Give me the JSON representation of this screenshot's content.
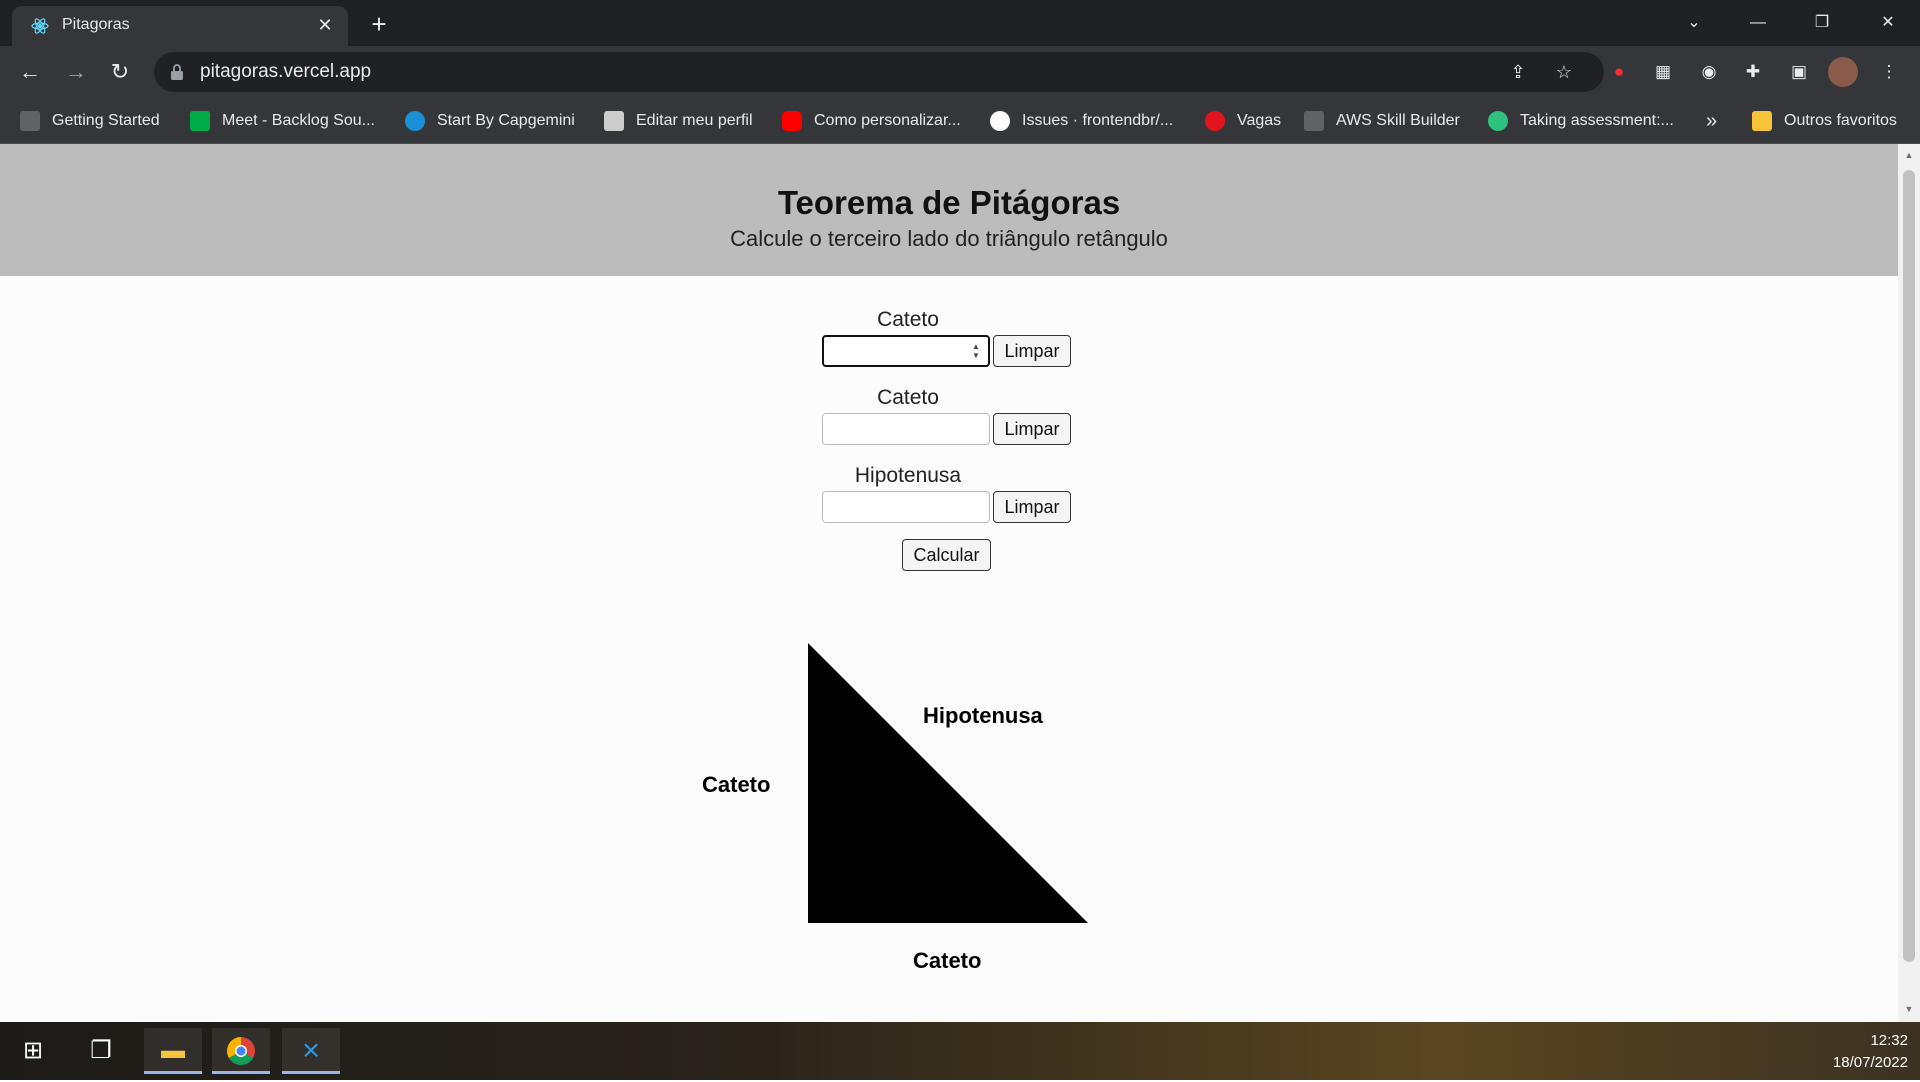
{
  "browser": {
    "tab_title": "Pitagoras",
    "url": "pitagoras.vercel.app",
    "bookmarks": [
      {
        "label": "Getting Started",
        "color": "#e8eaed"
      },
      {
        "label": "Meet - Backlog Sou...",
        "color": "#00ac47"
      },
      {
        "label": "Start By Capgemini",
        "color": "#1a8fd6"
      },
      {
        "label": "Editar meu perfil",
        "color": "#cccccc"
      },
      {
        "label": "Como personalizar...",
        "color": "#ff0000"
      },
      {
        "label": "Issues · frontendbr/...",
        "color": "#ffffff"
      },
      {
        "label": "Vagas",
        "color": "#e3141e"
      },
      {
        "label": "AWS Skill Builder",
        "color": "#e8eaed"
      },
      {
        "label": "Taking assessment:...",
        "color": "#2ec27e"
      }
    ],
    "overflow": "»",
    "other_bookmarks": "Outros favoritos"
  },
  "page": {
    "title": "Teorema de Pitágoras",
    "subtitle": "Calcule o terceiro lado do triângulo retângulo",
    "fields": [
      {
        "label": "Cateto",
        "value": "",
        "clear_label": "Limpar"
      },
      {
        "label": "Cateto",
        "value": "",
        "clear_label": "Limpar"
      },
      {
        "label": "Hipotenusa",
        "value": "",
        "clear_label": "Limpar"
      }
    ],
    "calculate_label": "Calcular",
    "triangle": {
      "hypotenuse_label": "Hipotenusa",
      "left_leg_label": "Cateto",
      "bottom_leg_label": "Cateto"
    }
  },
  "taskbar": {
    "time": "12:32",
    "date": "18/07/2022"
  }
}
